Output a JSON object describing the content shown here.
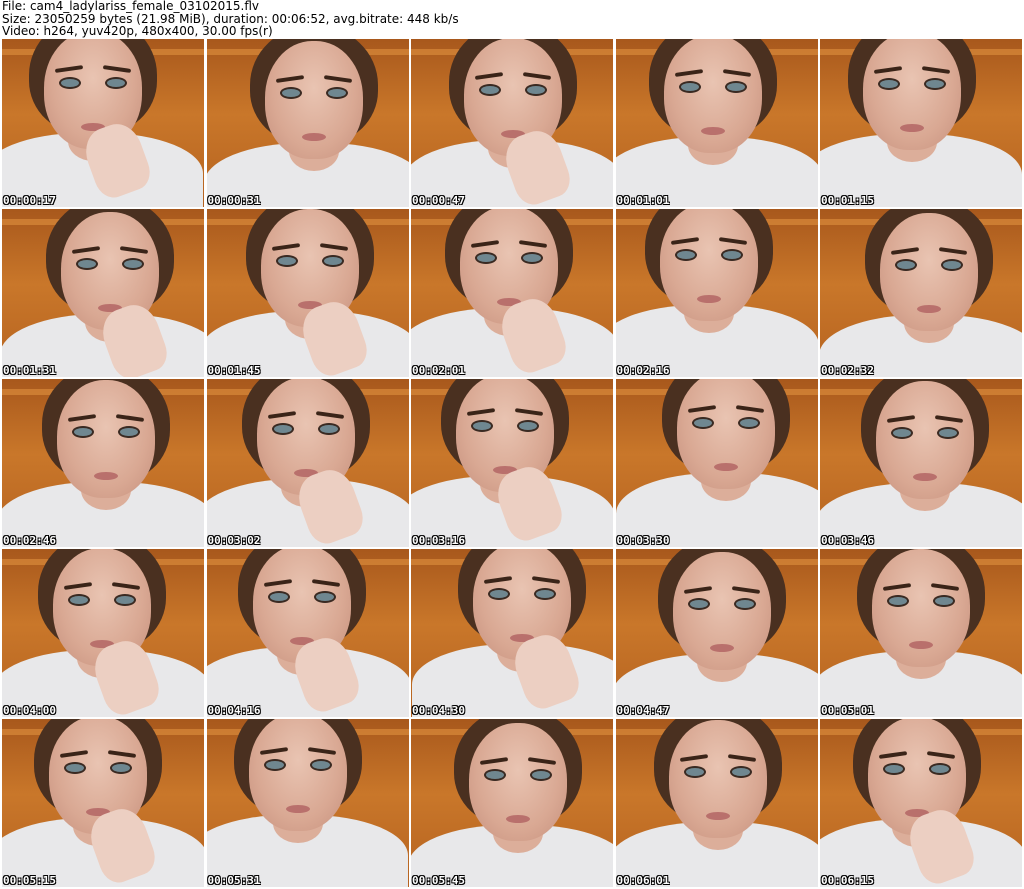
{
  "header": {
    "file": "File: cam4_ladylariss_female_03102015.flv",
    "size": "Size: 23050259 bytes (21.98 MiB), duration: 00:06:52, avg.bitrate: 448 kb/s",
    "video": "Video: h264, yuv420p, 480x400, 30.00 fps(r)"
  },
  "thumbnails": [
    {
      "timestamp": "00:00:17",
      "hand": true
    },
    {
      "timestamp": "00:00:31",
      "hand": false
    },
    {
      "timestamp": "00:00:47",
      "hand": true
    },
    {
      "timestamp": "00:01:01",
      "hand": false
    },
    {
      "timestamp": "00:01:15",
      "hand": false
    },
    {
      "timestamp": "00:01:31",
      "hand": true
    },
    {
      "timestamp": "00:01:45",
      "hand": true
    },
    {
      "timestamp": "00:02:01",
      "hand": true
    },
    {
      "timestamp": "00:02:16",
      "hand": false
    },
    {
      "timestamp": "00:02:32",
      "hand": false
    },
    {
      "timestamp": "00:02:46",
      "hand": false
    },
    {
      "timestamp": "00:03:02",
      "hand": true
    },
    {
      "timestamp": "00:03:16",
      "hand": true
    },
    {
      "timestamp": "00:03:30",
      "hand": false
    },
    {
      "timestamp": "00:03:46",
      "hand": false
    },
    {
      "timestamp": "00:04:00",
      "hand": true
    },
    {
      "timestamp": "00:04:16",
      "hand": true
    },
    {
      "timestamp": "00:04:30",
      "hand": true
    },
    {
      "timestamp": "00:04:47",
      "hand": false
    },
    {
      "timestamp": "00:05:01",
      "hand": false
    },
    {
      "timestamp": "00:05:15",
      "hand": true
    },
    {
      "timestamp": "00:05:31",
      "hand": false
    },
    {
      "timestamp": "00:05:45",
      "hand": false
    },
    {
      "timestamp": "00:06:01",
      "hand": false
    },
    {
      "timestamp": "00:06:15",
      "hand": true
    }
  ],
  "colors": {
    "background": "#ffffff",
    "wall": "#c06a22",
    "shirt": "#e8e8ea",
    "stamp_text": "#ffffff"
  }
}
